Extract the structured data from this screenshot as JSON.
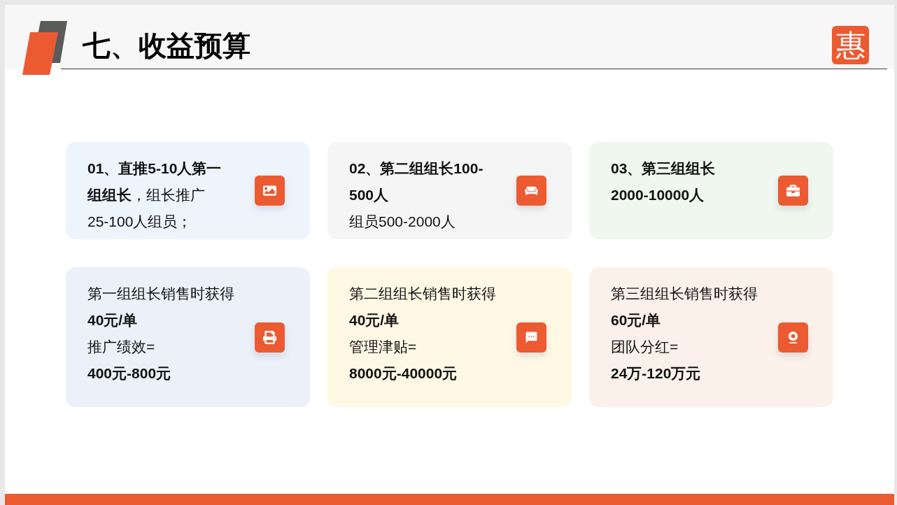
{
  "slide": {
    "title": "七、收益预算",
    "logo": "惠"
  },
  "tiers": [
    {
      "heading": "01、直推5-10人第一组组长",
      "body": "，组长推广25-100人组员；"
    },
    {
      "heading": "02、第二组组长100-500人",
      "note": "组员500-2000人"
    },
    {
      "heading": "03、第三组组长2000-10000人"
    }
  ],
  "earnings": [
    {
      "intro": "第一组组长销售时获得",
      "rate": "40元/单",
      "label": "推广绩效=",
      "amount": "400元-800元"
    },
    {
      "intro": "第二组组长销售时获得",
      "rate": "40元/单",
      "label": "管理津贴=",
      "amount": "8000元-40000元"
    },
    {
      "intro": "第三组组长销售时获得",
      "rate": "60元/单",
      "label": "团队分红=",
      "amount": "24万-120万元"
    }
  ]
}
